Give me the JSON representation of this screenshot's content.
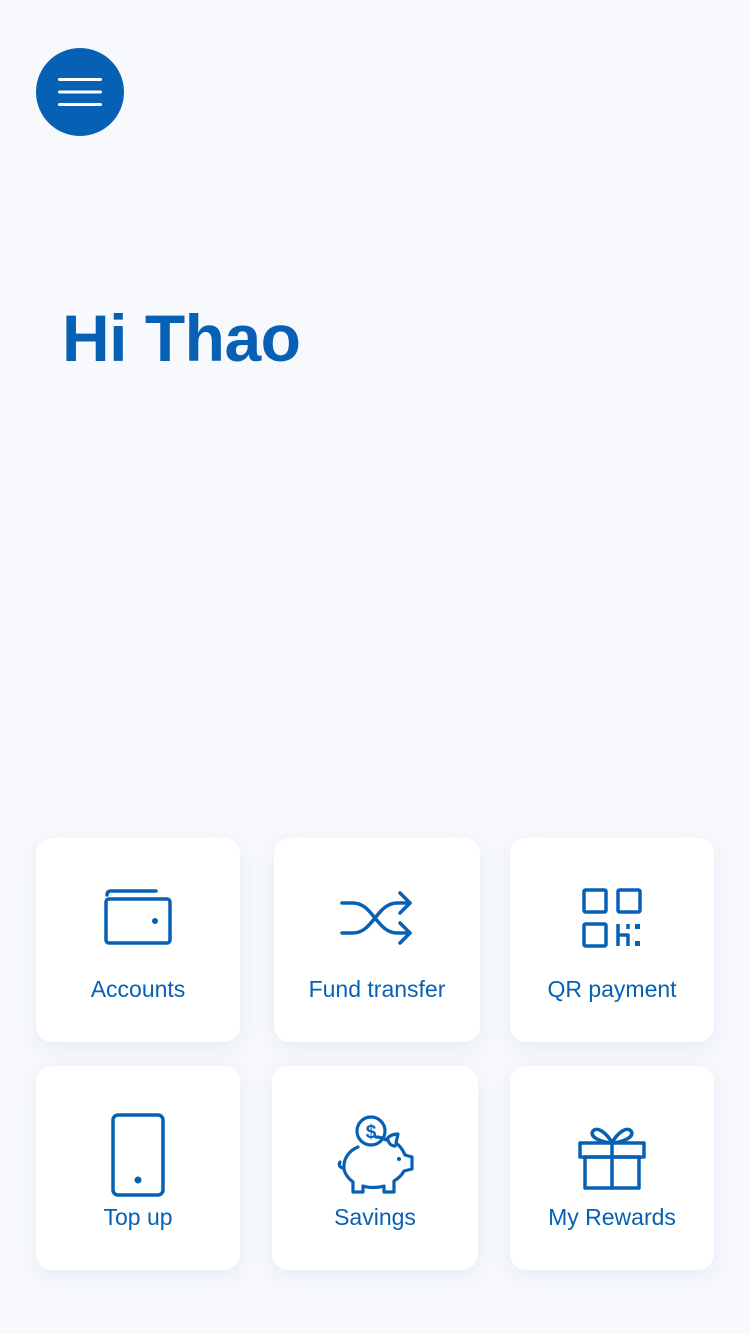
{
  "header": {
    "menu_icon": "hamburger-menu-icon"
  },
  "greeting": {
    "text": "Hi Thao"
  },
  "quick_actions": [
    {
      "label": "Accounts",
      "icon": "wallet-icon"
    },
    {
      "label": "Fund transfer",
      "icon": "shuffle-arrows-icon"
    },
    {
      "label": "QR payment",
      "icon": "qr-code-icon"
    },
    {
      "label": "Top up",
      "icon": "mobile-phone-icon"
    },
    {
      "label": "Savings",
      "icon": "piggy-bank-icon"
    },
    {
      "label": "My Rewards",
      "icon": "gift-icon"
    }
  ],
  "colors": {
    "brand_blue": "#0661b5",
    "background": "#f7f9fd",
    "tile_background": "#ffffff"
  }
}
